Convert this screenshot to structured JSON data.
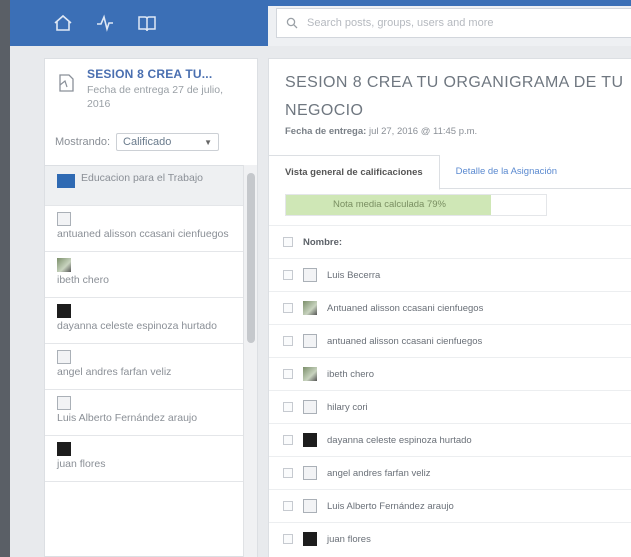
{
  "search": {
    "placeholder": "Search posts, groups, users and more"
  },
  "assignment": {
    "title": "SESION 8 CREA TU...",
    "due": "Fecha de entrega 27 de julio, 2016"
  },
  "filter": {
    "label": "Mostrando:",
    "selected": "Calificado"
  },
  "student_list": [
    {
      "name": "Educacion para el Trabajo",
      "type": "group"
    },
    {
      "name": "antuaned alisson ccasani cienfuegos",
      "avatar": "placeholder"
    },
    {
      "name": "ibeth chero",
      "avatar": "photo"
    },
    {
      "name": "dayanna celeste espinoza hurtado",
      "avatar": "dark"
    },
    {
      "name": "angel andres farfan veliz",
      "avatar": "placeholder"
    },
    {
      "name": "Luis Alberto Fernández araujo",
      "avatar": "placeholder"
    },
    {
      "name": "juan flores",
      "avatar": "dark"
    }
  ],
  "main": {
    "title": "SESION 8 CREA TU ORGANIGRAMA DE TU NEGOCIO",
    "due_label": "Fecha de entrega:",
    "due_value": "jul 27, 2016 @ 11:45 p.m.",
    "tabs": [
      "Vista general de calificaciones",
      "Detalle de la Asignación"
    ],
    "average_label": "Nota media calculada 79%",
    "average_value": 0.79,
    "column_header": "Nombre:",
    "rows": [
      {
        "name": "Luis Becerra",
        "avatar": "placeholder"
      },
      {
        "name": "Antuaned alisson ccasani cienfuegos",
        "avatar": "photo"
      },
      {
        "name": "antuaned alisson ccasani cienfuegos",
        "avatar": "placeholder"
      },
      {
        "name": "ibeth chero",
        "avatar": "photo"
      },
      {
        "name": "hilary cori",
        "avatar": "placeholder"
      },
      {
        "name": "dayanna celeste espinoza hurtado",
        "avatar": "dark"
      },
      {
        "name": "angel andres farfan veliz",
        "avatar": "placeholder"
      },
      {
        "name": "Luis Alberto Fernández araujo",
        "avatar": "placeholder"
      },
      {
        "name": "juan flores",
        "avatar": "dark"
      }
    ]
  },
  "icons": {
    "home": "home-icon",
    "activity": "activity-icon",
    "backpack": "book-icon",
    "search": "search-icon"
  },
  "colors": {
    "brand": "#3b6fb6",
    "group": "#2f6ab3",
    "average_fill": "#cfe7b6",
    "link": "#5b8ad0"
  }
}
